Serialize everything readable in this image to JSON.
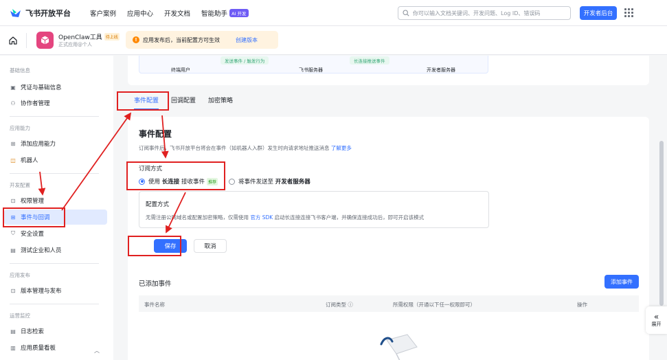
{
  "topbar": {
    "brand": "飞书开放平台",
    "nav": [
      "客户案例",
      "应用中心",
      "开发文档",
      "智能助手"
    ],
    "ai_badge": "AI 开发",
    "search_placeholder": "你可以输入文档关键词、开发问题、Log ID、错误码",
    "dev_console": "开发者后台"
  },
  "appbar": {
    "app_name": "OpenClaw工具",
    "app_tag": "待上线",
    "app_sub": "正式应用@个人",
    "notice": "应用发布后，当前配置方可生效",
    "notice_link": "创建版本"
  },
  "sidebar": {
    "groups": [
      {
        "label": "基础信息",
        "items": [
          {
            "label": "凭证与基础信息",
            "icon": "card-icon"
          },
          {
            "label": "协作者管理",
            "icon": "user-icon"
          }
        ]
      },
      {
        "label": "应用能力",
        "items": [
          {
            "label": "添加应用能力",
            "icon": "grid-plus-icon"
          },
          {
            "label": "机器人",
            "icon": "robot-icon"
          }
        ]
      },
      {
        "label": "开发配置",
        "items": [
          {
            "label": "权限管理",
            "icon": "lock-icon"
          },
          {
            "label": "事件与回调",
            "icon": "event-icon",
            "active": true
          },
          {
            "label": "安全设置",
            "icon": "shield-icon"
          },
          {
            "label": "测试企业和人员",
            "icon": "test-icon"
          }
        ]
      },
      {
        "label": "应用发布",
        "items": [
          {
            "label": "版本管理与发布",
            "icon": "upload-icon"
          }
        ]
      },
      {
        "label": "运营监控",
        "items": [
          {
            "label": "日志检索",
            "icon": "log-icon"
          },
          {
            "label": "应用质量看板",
            "icon": "chart-icon"
          }
        ]
      }
    ]
  },
  "diagram": {
    "labels": [
      "终端用户",
      "飞书服务器",
      "开发者服务器"
    ],
    "flows": [
      "发送事件 / 触发行为",
      "长连接推送事件"
    ]
  },
  "tabs": [
    "事件配置",
    "回调配置",
    "加密策略"
  ],
  "config": {
    "title": "事件配置",
    "desc": "订阅事件后，飞书开放平台将会在事件（如机器人入群）发生时向请求地址推送消息",
    "desc_link": "了解更多",
    "sub_label": "订阅方式",
    "opt1_prefix": "使用",
    "opt1_bold": "长连接",
    "opt1_suffix": "接收事件",
    "opt1_tag": "推荐",
    "opt2_prefix": "将事件发送至",
    "opt2_bold": "开发者服务器",
    "mode_title": "配置方式",
    "mode_text_a": "无需注册公网域名或配置加密策略，仅需使用",
    "mode_link": "官方 SDK",
    "mode_text_b": "启动长连接连接飞书客户端，并确保连接成功后，即可开启该模式",
    "save": "保存",
    "cancel": "取消"
  },
  "added": {
    "title": "已添加事件",
    "add_button": "添加事件",
    "columns": [
      "事件名称",
      "订阅类型 ⓘ",
      "所需权限（开通以下任一权限即可）",
      "操作"
    ]
  },
  "collapse_label": "展开",
  "colors": {
    "primary": "#3370ff",
    "annotation_red": "#e02020",
    "warning": "#ff8800"
  }
}
